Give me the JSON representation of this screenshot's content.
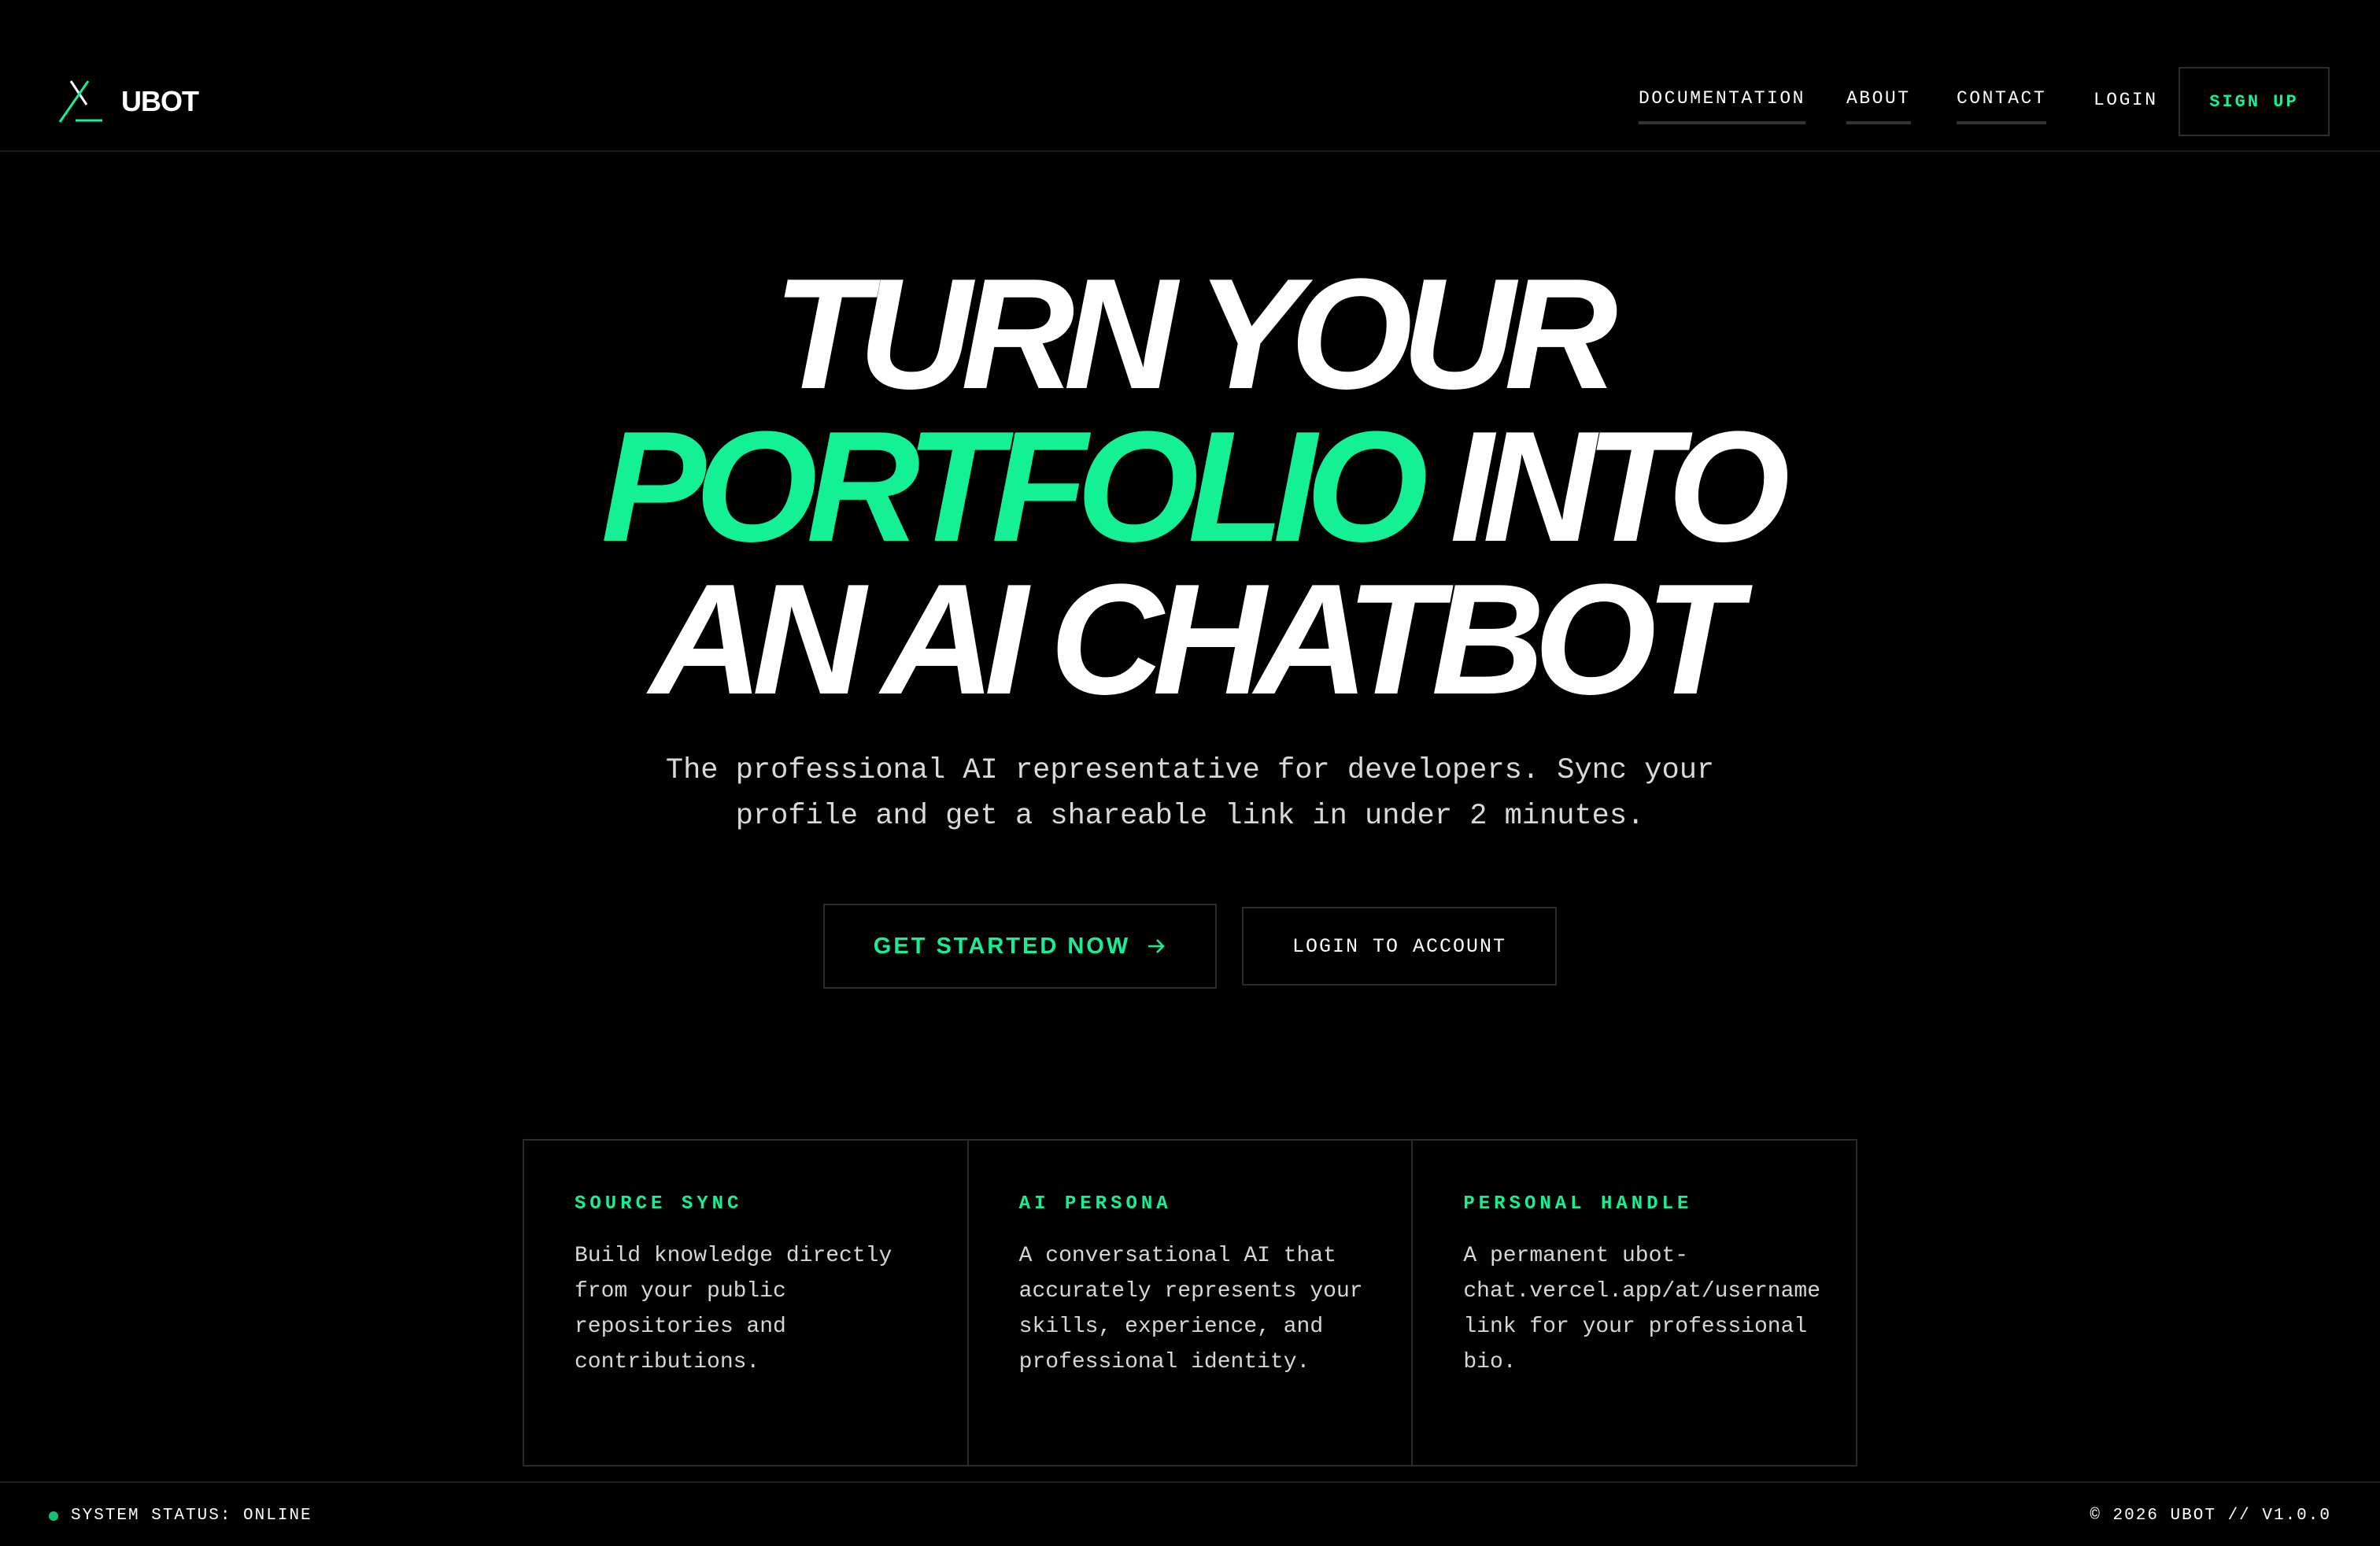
{
  "brand": {
    "name": "UBOT",
    "logo_icon": "x-slash-logo-icon",
    "accent_color": "#14f195"
  },
  "nav": {
    "items": [
      {
        "label": "DOCUMENTATION"
      },
      {
        "label": "ABOUT"
      },
      {
        "label": "CONTACT"
      },
      {
        "label": "LOGIN"
      }
    ],
    "signup_label": "SIGN UP"
  },
  "hero": {
    "line1": "TURN YOUR",
    "line2_accent": "PORTFOLIO",
    "line2_rest": "INTO",
    "line3": "AN AI CHATBOT",
    "subtitle_line1": "The professional AI representative for developers. Sync your",
    "subtitle_line2": "profile and get a shareable link in under 2 minutes.",
    "primary_cta": "GET STARTED NOW",
    "primary_cta_icon": "arrow-right-icon",
    "secondary_cta": "LOGIN TO ACCOUNT"
  },
  "features": [
    {
      "title": "SOURCE SYNC",
      "description": "Build knowledge directly from your public repositories and contributions."
    },
    {
      "title": "AI PERSONA",
      "description": "A conversational AI that accurately represents your skills, experience, and professional identity."
    },
    {
      "title": "PERSONAL HANDLE",
      "description": "A permanent ubot-chat.vercel.app/at/username link for your professional bio."
    }
  ],
  "footer": {
    "status": "SYSTEM STATUS: ONLINE",
    "copyright": "© 2026 UBOT // V1.0.0"
  }
}
